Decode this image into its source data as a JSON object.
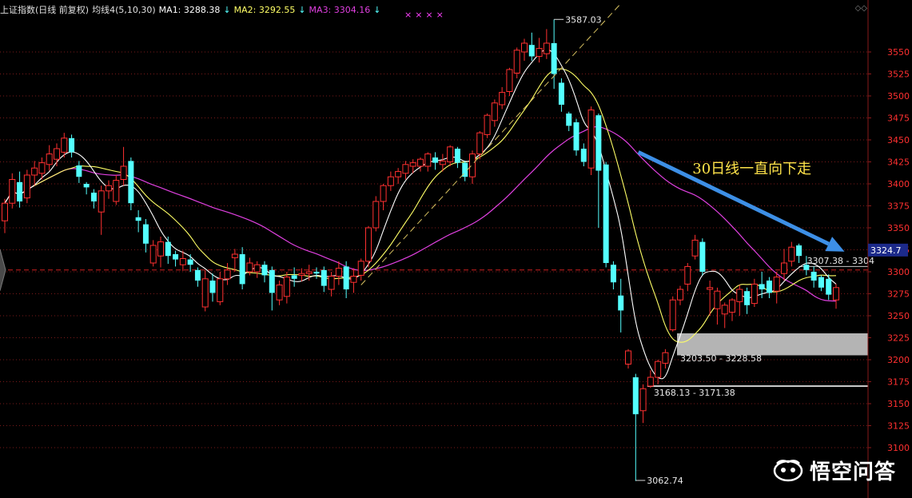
{
  "header": {
    "title": "上证指数(日线 前复权)",
    "ma_group": "均线4(5,10,30)",
    "ma1_label": "MA1: 3288.38",
    "ma2_label": "MA2: 3292.55",
    "ma3_label": "MA3: 3304.16",
    "arrow_down": "↓",
    "stars": "××××",
    "toggles": "◇◇"
  },
  "colors": {
    "up": "#ff3030",
    "down": "#54ffff",
    "ma1": "#ffffff",
    "ma2": "#ffff66",
    "ma3": "#e040e0",
    "grid": "#7a1a1a",
    "axis_text": "#ff3030",
    "arrow": "#3d8fe6",
    "zone": "#c8c8c8"
  },
  "chart_data": {
    "type": "candlestick",
    "y_range": [
      3085,
      3575
    ],
    "y_ticks": [
      3100,
      3125,
      3150,
      3175,
      3200,
      3225,
      3250,
      3275,
      3300,
      3325,
      3350,
      3375,
      3400,
      3425,
      3450,
      3475,
      3500,
      3525,
      3550
    ],
    "current_price_label": "3324.7",
    "current_price": 3324.7,
    "ref_line": 3302,
    "candles": [
      [
        3358,
        3378,
        3344,
        3383
      ],
      [
        3378,
        3405,
        3372,
        3412
      ],
      [
        3402,
        3380,
        3373,
        3414
      ],
      [
        3384,
        3410,
        3378,
        3416
      ],
      [
        3410,
        3418,
        3398,
        3426
      ],
      [
        3412,
        3424,
        3405,
        3430
      ],
      [
        3422,
        3434,
        3415,
        3444
      ],
      [
        3428,
        3440,
        3420,
        3446
      ],
      [
        3436,
        3452,
        3430,
        3458
      ],
      [
        3452,
        3436,
        3430,
        3456
      ],
      [
        3421,
        3408,
        3401,
        3426
      ],
      [
        3400,
        3396,
        3388,
        3402
      ],
      [
        3390,
        3380,
        3372,
        3394
      ],
      [
        3368,
        3392,
        3342,
        3398
      ],
      [
        3392,
        3398,
        3383,
        3404
      ],
      [
        3380,
        3404,
        3376,
        3410
      ],
      [
        3405,
        3420,
        3398,
        3442
      ],
      [
        3426,
        3378,
        3370,
        3430
      ],
      [
        3362,
        3358,
        3345,
        3370
      ],
      [
        3354,
        3332,
        3322,
        3360
      ],
      [
        3310,
        3330,
        3306,
        3336
      ],
      [
        3318,
        3334,
        3305,
        3340
      ],
      [
        3334,
        3318,
        3309,
        3340
      ],
      [
        3320,
        3314,
        3306,
        3324
      ],
      [
        3308,
        3315,
        3301,
        3324
      ],
      [
        3314,
        3308,
        3300,
        3320
      ],
      [
        3302,
        3290,
        3283,
        3305
      ],
      [
        3260,
        3292,
        3255,
        3302
      ],
      [
        3290,
        3276,
        3266,
        3298
      ],
      [
        3266,
        3292,
        3262,
        3300
      ],
      [
        3292,
        3302,
        3285,
        3310
      ],
      [
        3316,
        3320,
        3300,
        3326
      ],
      [
        3320,
        3286,
        3280,
        3328
      ],
      [
        3300,
        3310,
        3296,
        3316
      ],
      [
        3300,
        3308,
        3293,
        3312
      ],
      [
        3308,
        3296,
        3288,
        3312
      ],
      [
        3302,
        3276,
        3256,
        3306
      ],
      [
        3268,
        3285,
        3262,
        3290
      ],
      [
        3272,
        3294,
        3264,
        3300
      ],
      [
        3296,
        3292,
        3283,
        3305
      ],
      [
        3296,
        3298,
        3289,
        3304
      ],
      [
        3298,
        3300,
        3290,
        3308
      ],
      [
        3300,
        3298,
        3292,
        3305
      ],
      [
        3302,
        3284,
        3277,
        3306
      ],
      [
        3280,
        3295,
        3272,
        3300
      ],
      [
        3295,
        3304,
        3285,
        3312
      ],
      [
        3306,
        3280,
        3270,
        3312
      ],
      [
        3288,
        3295,
        3276,
        3304
      ],
      [
        3296,
        3312,
        3290,
        3315
      ],
      [
        3312,
        3350,
        3305,
        3352
      ],
      [
        3350,
        3380,
        3346,
        3386
      ],
      [
        3380,
        3398,
        3370,
        3400
      ],
      [
        3398,
        3408,
        3392,
        3414
      ],
      [
        3408,
        3414,
        3400,
        3418
      ],
      [
        3412,
        3422,
        3405,
        3426
      ],
      [
        3420,
        3424,
        3412,
        3428
      ],
      [
        3420,
        3428,
        3414,
        3430
      ],
      [
        3420,
        3434,
        3414,
        3436
      ],
      [
        3430,
        3424,
        3416,
        3436
      ],
      [
        3422,
        3426,
        3414,
        3434
      ],
      [
        3425,
        3442,
        3420,
        3444
      ],
      [
        3440,
        3424,
        3418,
        3442
      ],
      [
        3424,
        3408,
        3403,
        3426
      ],
      [
        3408,
        3434,
        3400,
        3438
      ],
      [
        3434,
        3458,
        3428,
        3460
      ],
      [
        3456,
        3478,
        3452,
        3480
      ],
      [
        3472,
        3492,
        3465,
        3496
      ],
      [
        3490,
        3504,
        3485,
        3510
      ],
      [
        3505,
        3530,
        3500,
        3532
      ],
      [
        3526,
        3552,
        3520,
        3555
      ],
      [
        3550,
        3560,
        3540,
        3565
      ],
      [
        3558,
        3545,
        3540,
        3572
      ],
      [
        3545,
        3554,
        3538,
        3566
      ],
      [
        3548,
        3560,
        3542,
        3576
      ],
      [
        3560,
        3525,
        3508,
        3587
      ],
      [
        3515,
        3490,
        3482,
        3520
      ],
      [
        3480,
        3466,
        3460,
        3482
      ],
      [
        3470,
        3438,
        3432,
        3474
      ],
      [
        3440,
        3425,
        3420,
        3446
      ],
      [
        3418,
        3484,
        3410,
        3488
      ],
      [
        3478,
        3415,
        3350,
        3480
      ],
      [
        3422,
        3310,
        3305,
        3425
      ],
      [
        3308,
        3288,
        3280,
        3312
      ],
      [
        3273,
        3256,
        3231,
        3292
      ],
      [
        3195,
        3210,
        3190,
        3212
      ],
      [
        3180,
        3138,
        3062,
        3184
      ],
      [
        3142,
        3167,
        3128,
        3172
      ],
      [
        3170,
        3180,
        3168,
        3188
      ],
      [
        3180,
        3198,
        3172,
        3200
      ],
      [
        3196,
        3208,
        3190,
        3212
      ],
      [
        3234,
        3268,
        3232,
        3272
      ],
      [
        3268,
        3280,
        3262,
        3284
      ],
      [
        3286,
        3306,
        3278,
        3310
      ],
      [
        3318,
        3336,
        3314,
        3342
      ],
      [
        3334,
        3300,
        3296,
        3338
      ],
      [
        3280,
        3282,
        3250,
        3290
      ],
      [
        3258,
        3278,
        3240,
        3282
      ],
      [
        3252,
        3262,
        3236,
        3265
      ],
      [
        3254,
        3268,
        3244,
        3270
      ],
      [
        3266,
        3280,
        3250,
        3285
      ],
      [
        3278,
        3262,
        3252,
        3282
      ],
      [
        3264,
        3286,
        3260,
        3292
      ],
      [
        3286,
        3280,
        3270,
        3300
      ],
      [
        3290,
        3276,
        3270,
        3294
      ],
      [
        3278,
        3294,
        3264,
        3300
      ],
      [
        3298,
        3310,
        3290,
        3326
      ],
      [
        3312,
        3328,
        3306,
        3334
      ],
      [
        3330,
        3318,
        3310,
        3332
      ],
      [
        3308,
        3302,
        3296,
        3318
      ],
      [
        3300,
        3290,
        3282,
        3306
      ],
      [
        3294,
        3282,
        3278,
        3296
      ],
      [
        3292,
        3274,
        3268,
        3297
      ],
      [
        3268,
        3282,
        3258,
        3286
      ]
    ],
    "annotations": [
      {
        "text": "3587.03",
        "value": 3587.03,
        "index": 74
      },
      {
        "text": "3062.74",
        "value": 3062.74,
        "index": 85
      },
      {
        "text": "3203.50 - 3228.58",
        "low": 3203.5,
        "high": 3228.58,
        "start_index": 91
      },
      {
        "text": "3168.13 - 3171.38",
        "low": 3168.13,
        "high": 3171.38,
        "start_index": 87
      },
      {
        "text": "3307.38 - 3304",
        "low": 3304,
        "high": 3307.38,
        "start_index": 107
      }
    ],
    "callout": "30日线一直向下走"
  },
  "watermark": {
    "text": "悟空问答"
  }
}
